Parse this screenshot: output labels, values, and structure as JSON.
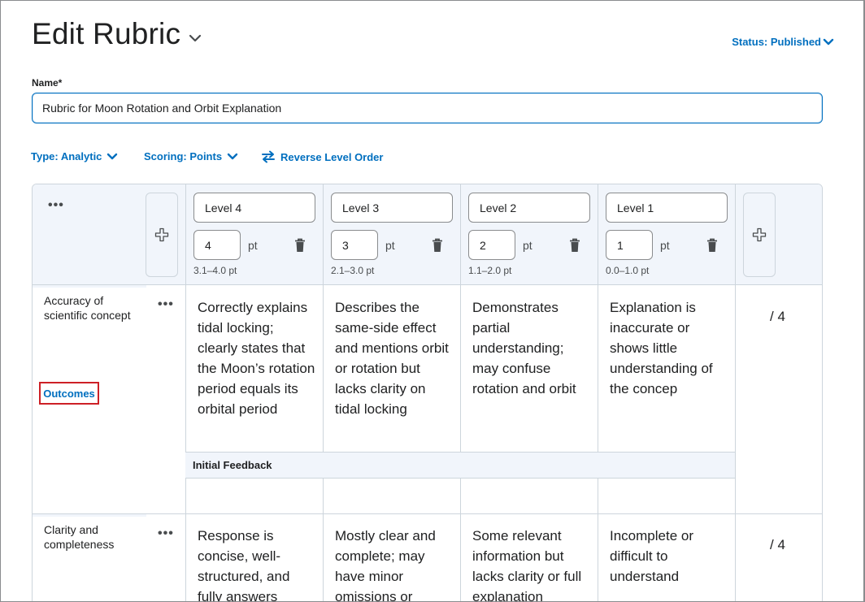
{
  "header": {
    "title": "Edit Rubric",
    "status_label": "Status: Published"
  },
  "form": {
    "name_label": "Name*",
    "name_value": "Rubric for Moon Rotation and Orbit Explanation"
  },
  "options": {
    "type_label": "Type: Analytic",
    "scoring_label": "Scoring: Points",
    "reverse_label": "Reverse Level Order"
  },
  "levels": [
    {
      "name": "Level 4",
      "points": "4",
      "unit": "pt",
      "range": "3.1–4.0 pt"
    },
    {
      "name": "Level 3",
      "points": "3",
      "unit": "pt",
      "range": "2.1–3.0 pt"
    },
    {
      "name": "Level 2",
      "points": "2",
      "unit": "pt",
      "range": "1.1–2.0 pt"
    },
    {
      "name": "Level 1",
      "points": "1",
      "unit": "pt",
      "range": "0.0–1.0 pt"
    }
  ],
  "criteria": [
    {
      "name": "Accuracy of scientific concept",
      "outcomes_label": "Outcomes",
      "descriptions": [
        "Correctly explains tidal locking; clearly states that the Moon’s rotation period equals its orbital period",
        "Describes the same-side effect and mentions orbit or rotation but lacks clarity on tidal locking",
        "Demonstrates partial understanding; may confuse rotation and orbit",
        "Explanation is inaccurate or shows little understanding of the concep"
      ],
      "score": "/ 4",
      "feedback_label": "Initial Feedback"
    },
    {
      "name": "Clarity and completeness",
      "descriptions": [
        "Response is concise, well-structured, and fully answers",
        "Mostly clear and complete; may have minor omissions or",
        "Some relevant information but lacks clarity or full explanation",
        "Incomplete or difficult to understand"
      ],
      "score": "/ 4"
    }
  ],
  "colors": {
    "accent": "#006fbf",
    "header_bg": "#f1f5fb",
    "border": "#cdd5dc",
    "highlight": "#cd2026"
  }
}
